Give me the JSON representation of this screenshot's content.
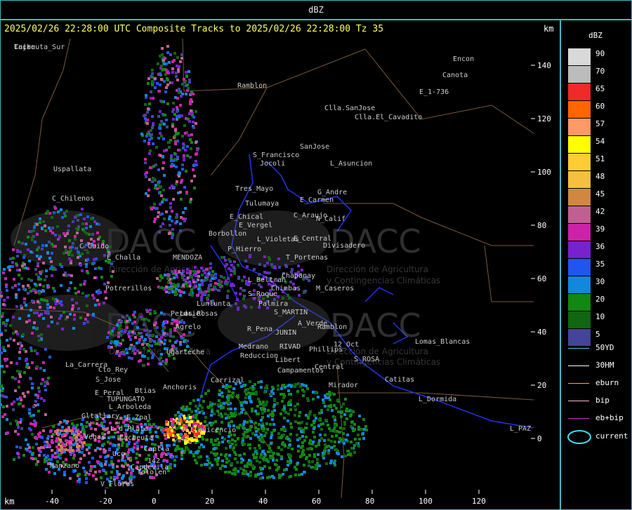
{
  "title": "dBZ",
  "header_line": "2025/02/26 22:28:00 UTC Composite Tracks to 2025/02/26 22:28:00 Tz 35",
  "km_unit": "km",
  "y_axis_ticks": [
    "140",
    "120",
    "100",
    "80",
    "60",
    "40",
    "20",
    "0"
  ],
  "x_axis_ticks": [
    "-40",
    "-20",
    "0",
    "20",
    "40",
    "60",
    "80",
    "100",
    "120"
  ],
  "legend": {
    "title": "dBZ",
    "scale": [
      {
        "label": "90",
        "color": "#d9d9d9"
      },
      {
        "label": "70",
        "color": "#bcbcbc"
      },
      {
        "label": "65",
        "color": "#f02a2a"
      },
      {
        "label": "60",
        "color": "#ff6600"
      },
      {
        "label": "57",
        "color": "#ff9966"
      },
      {
        "label": "54",
        "color": "#ffff00"
      },
      {
        "label": "51",
        "color": "#ffcc33"
      },
      {
        "label": "48",
        "color": "#f5c040"
      },
      {
        "label": "45",
        "color": "#d08840"
      },
      {
        "label": "42",
        "color": "#c06090"
      },
      {
        "label": "39",
        "color": "#cc22aa"
      },
      {
        "label": "36",
        "color": "#7722cc"
      },
      {
        "label": "35",
        "color": "#2255ee"
      },
      {
        "label": "30",
        "color": "#1188dd"
      },
      {
        "label": "20",
        "color": "#118811"
      },
      {
        "label": "10",
        "color": "#116611"
      },
      {
        "label": "5",
        "color": "#444499"
      }
    ],
    "tracks": [
      {
        "label": "50YD",
        "color": "#3fd0e0"
      },
      {
        "label": "30HM",
        "color": "#ffffff"
      },
      {
        "label": "eburn",
        "color": "#ffaa33"
      },
      {
        "label": "bip",
        "color": "#ffbbcc"
      },
      {
        "label": "eb+bip",
        "color": "#cc33cc"
      }
    ],
    "current_label": "current"
  },
  "watermark": {
    "brand": "DACC",
    "line1": "Dirección de Agricultura",
    "line2": "y Contingencias Climáticas"
  },
  "places": [
    "Encon",
    "E_1-736",
    "Ramblon",
    "Clla.SanJose",
    "Clla.El_Cavadito",
    "SanJose",
    "Uspallata",
    "S_Francisco",
    "Jocoli",
    "L_Asuncion",
    "Tres_Mayo",
    "G_Andre",
    "Tulumaya",
    "E_Carmen",
    "C_Chilenos",
    "E_Chical",
    "C_Araujo",
    "E_Vergel",
    "N_Calif",
    "Borbollon",
    "L_Violetas",
    "E_Central",
    "C_Guido",
    "P_Hierro",
    "Divisadero",
    "E_Challa",
    "MENDOZA",
    "T_Portenas",
    "Chapanay",
    "L_Beltran",
    "Potrerillos",
    "M_Caseros",
    "Chimbas",
    "S_Roque",
    "Palmira",
    "Lunlunta",
    "S_MARTIN",
    "Perdriel",
    "A_Verde",
    "R_Pena",
    "JUNIN",
    "Agrelo",
    "Ramblon",
    "12_Oct",
    "Lomas_Blancas",
    "Phillips",
    "RIVAD",
    "Medrano",
    "Reduccion",
    "Ugarteche",
    "Libert",
    "S_ROSA",
    "Campamentos",
    "Central",
    "La_Carrera",
    "Cto_Rey",
    "S_Jose",
    "Carrizal",
    "Catitas",
    "Mirador",
    "E_Peral",
    "Btias",
    "Anchoris",
    "TUPUNGATO",
    "L_Arboleda",
    "L_Dormida",
    "E_Zpal",
    "Gltallary",
    "L_d_Plata",
    "L_PAZ",
    "Manzano",
    "V_Flores",
    "Vegas",
    "Cacheuta",
    "Caplla",
    "Tololen",
    "Villavicencio",
    "Capdevila",
    "Canota",
    "Uco",
    "Las_Rosas",
    "142",
    "Cacheuta_Sur",
    "Lujan",
    "Taire"
  ]
}
